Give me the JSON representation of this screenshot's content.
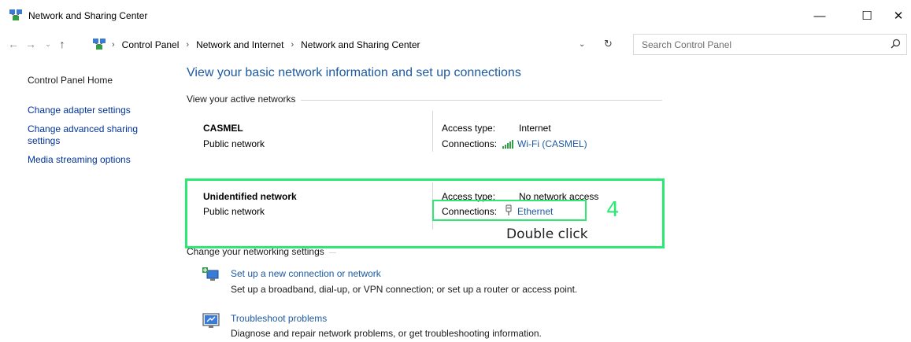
{
  "window": {
    "title": "Network and Sharing Center",
    "minimize_glyph": "—",
    "maximize_glyph": "☐",
    "close_glyph": "✕"
  },
  "address": {
    "back_glyph": "←",
    "forward_glyph": "→",
    "recent_glyph": "⌄",
    "up_glyph": "↑",
    "separator": "›",
    "crumbs": [
      "Control Panel",
      "Network and Internet",
      "Network and Sharing Center"
    ],
    "dropdown_glyph": "⌄",
    "refresh_glyph": "↻",
    "search_placeholder": "Search Control Panel"
  },
  "sidebar": {
    "home": "Control Panel Home",
    "items": [
      "Change adapter settings",
      "Change advanced sharing settings",
      "Media streaming options"
    ]
  },
  "main": {
    "heading": "View your basic network information and set up connections",
    "active_label": "View your active networks",
    "networks": [
      {
        "name": "CASMEL",
        "category": "Public network",
        "access_type_label": "Access type:",
        "access_type": "Internet",
        "connections_label": "Connections:",
        "connection": "Wi-Fi (CASMEL)",
        "icon": "wifi-signal-icon"
      },
      {
        "name": "Unidentified network",
        "category": "Public network",
        "access_type_label": "Access type:",
        "access_type": "No network access",
        "connections_label": "Connections:",
        "connection": "Ethernet",
        "icon": "ethernet-icon"
      }
    ],
    "change_label": "Change your networking settings",
    "tasks": [
      {
        "link": "Set up a new connection or network",
        "desc": "Set up a broadband, dial-up, or VPN connection; or set up a router or access point.",
        "icon": "new-connection-icon"
      },
      {
        "link": "Troubleshoot problems",
        "desc": "Diagnose and repair network problems, or get troubleshooting information.",
        "icon": "troubleshoot-icon"
      }
    ]
  },
  "annotation": {
    "step": "4",
    "text": "Double click",
    "color": "#2ee874"
  },
  "colors": {
    "link": "#1e5aa0",
    "sidebar_link": "#003399"
  }
}
